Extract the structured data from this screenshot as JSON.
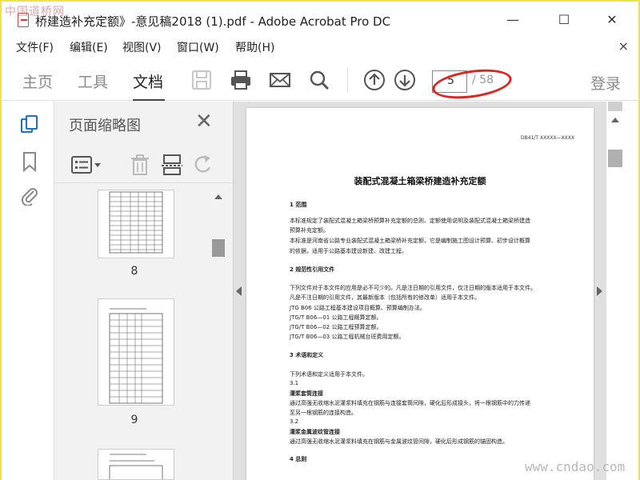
{
  "window": {
    "title": "桥建造补充定额》-意见稿2018 (1).pdf - Adobe Acrobat Pro DC",
    "minimize": "—",
    "maximize": "☐",
    "close": "✕"
  },
  "watermark_top": "中国道桥网",
  "watermark_bottom": "www.cndao.com",
  "menu": {
    "items": [
      "文件(F)",
      "编辑(E)",
      "视图(V)",
      "窗口(W)",
      "帮助(H)"
    ],
    "close": "×"
  },
  "toolbar": {
    "tabs": [
      "主页",
      "工具",
      "文档"
    ],
    "active_tab": "文档",
    "icons": [
      "save-icon",
      "print-icon",
      "email-icon",
      "search-icon",
      "page-up-icon",
      "page-down-icon"
    ],
    "page_current": "5",
    "page_total": "/ 58",
    "login": "登录"
  },
  "sidebar_rail": {
    "icons": [
      "page-thumbnails-icon",
      "bookmarks-icon",
      "attachments-icon"
    ]
  },
  "thumbnail_panel": {
    "title": "页面缩略图",
    "close": "✕",
    "tools": [
      "options-menu-icon",
      "delete-icon",
      "extract-icon",
      "rotate-icon"
    ],
    "pages": [
      "8",
      "9"
    ]
  },
  "document": {
    "code": "DB41/T XXXXX—XXXX",
    "title": "装配式混凝土箱梁桥建造补充定额",
    "lines": [
      "1  范围",
      "    本标准规定了装配式混凝土箱梁桥预算补充定额的总则、定额使用说明及装配式混凝土箱梁桥建造",
      "预算补充定额。",
      "    本标准是河南省公路专业装配式混凝土箱梁桥补充定额，它是编制施工图设计预算、初步设计概算",
      "的依据，适用于公路基本建设新建、改建工程。",
      "2  规范性引用文件",
      "    下列文件对于本文件的应用是必不可少的。凡是注日期的引用文件，仅注日期的版本适用于本文件。",
      "凡是不注日期的引用文件，其最新版本（包括所有的修改单）适用于本文件。",
      "    JTG B06   公路工程基本建设项目概算、预算编制办法。",
      "    JTG/T B06—01   公路工程概算定额。",
      "    JTG/T B06—02   公路工程预算定额。",
      "    JTG/T B06—03   公路工程机械台班费用定额。",
      "3  术语和定义",
      "    下列术语和定义适用于本文件。",
      "3.1",
      "    灌浆套筒连接",
      "    通过高强无收缩水泥灌浆料填充在钢筋与连接套筒间隙，硬化后形成接头，将一根钢筋中的力传递",
      "至另一根钢筋的连接构造。",
      "3.2",
      "    灌浆金属波纹管连接",
      "    通过高强无收缩水泥灌浆料填充在钢筋与金属波纹管间隙，硬化后形成钢筋的锚固构造。",
      "4  总则"
    ]
  },
  "colors": {
    "frame_border": "#f2e24a",
    "annotation_ellipse": "#e02424",
    "panel_bg": "#f2f2f2",
    "doc_bg": "#e0e0e0"
  }
}
